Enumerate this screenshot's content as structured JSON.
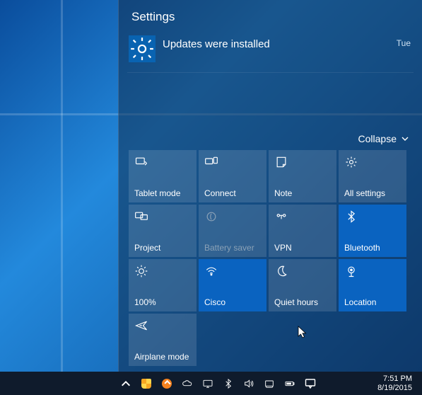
{
  "panel": {
    "title": "Settings",
    "notification": {
      "text": "Updates were installed",
      "day": "Tue",
      "icon": "gear-icon"
    },
    "collapse_label": "Collapse"
  },
  "tiles": [
    {
      "id": "tablet-mode",
      "label": "Tablet mode",
      "icon": "tablet-touch-icon",
      "accent": false
    },
    {
      "id": "connect",
      "label": "Connect",
      "icon": "connect-icon",
      "accent": false
    },
    {
      "id": "note",
      "label": "Note",
      "icon": "note-icon",
      "accent": false
    },
    {
      "id": "all-settings",
      "label": "All settings",
      "icon": "gear-icon",
      "accent": false
    },
    {
      "id": "project",
      "label": "Project",
      "icon": "project-icon",
      "accent": false
    },
    {
      "id": "battery-saver",
      "label": "Battery saver",
      "icon": "leaf-icon",
      "accent": false,
      "dim": true
    },
    {
      "id": "vpn",
      "label": "VPN",
      "icon": "vpn-icon",
      "accent": false
    },
    {
      "id": "bluetooth",
      "label": "Bluetooth",
      "icon": "bluetooth-icon",
      "accent": true
    },
    {
      "id": "brightness",
      "label": "100%",
      "icon": "brightness-icon",
      "accent": false
    },
    {
      "id": "network",
      "label": "Cisco",
      "icon": "wifi-icon",
      "accent": true
    },
    {
      "id": "quiet-hours",
      "label": "Quiet hours",
      "icon": "moon-icon",
      "accent": false
    },
    {
      "id": "location",
      "label": "Location",
      "icon": "location-icon",
      "accent": true
    },
    {
      "id": "airplane-mode",
      "label": "Airplane mode",
      "icon": "airplane-icon",
      "accent": false
    }
  ],
  "taskbar": {
    "tray_icons": [
      "chevron-up-icon",
      "security-shield-icon",
      "update-arrow-icon",
      "onedrive-icon",
      "display-icon",
      "bluetooth-icon",
      "volume-icon",
      "network-icon",
      "battery-icon"
    ],
    "action_center_icon": "action-center-icon",
    "time": "7:51 PM",
    "date": "8/19/2015"
  }
}
